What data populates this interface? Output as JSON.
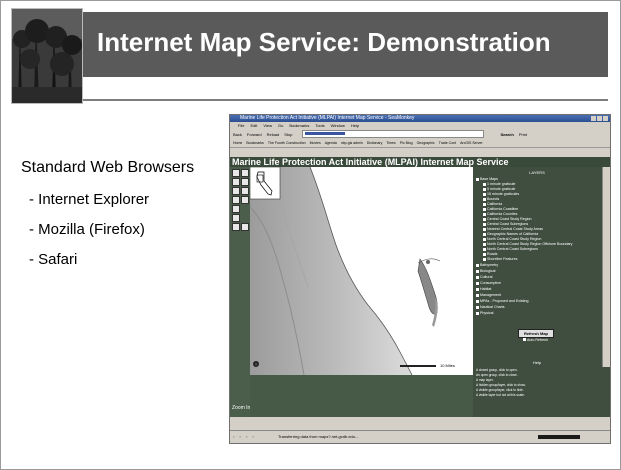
{
  "slide": {
    "title": "Internet Map Service: Demonstration"
  },
  "bullets": {
    "heading": "Standard Web Browsers",
    "items": [
      "- Internet Explorer",
      "- Mozilla (Firefox)",
      "- Safari"
    ]
  },
  "browser": {
    "window_title": "Marine Life Protection Act Initiative (MLPAI) Internet Map Service - SeaMonkey",
    "menu": [
      "File",
      "Edit",
      "View",
      "Go",
      "Bookmarks",
      "Tools",
      "Window",
      "Help"
    ],
    "nav": {
      "back": "Back",
      "forward": "Forward",
      "reload": "Reload",
      "stop": "Stop",
      "search": "Search",
      "print": "Print"
    },
    "bookmarks": [
      "Home",
      "Bookmarks",
      "The Fourth Construction",
      "Movies",
      "Agenda",
      "nbp-gis admin",
      "Dictionary",
      "Times",
      "Pic Blog",
      "Geographic",
      "Trade Cont",
      "ArcGIS Server"
    ],
    "page_header": "Marine Life Protection Act Initiative (MLPAI) Internet Map Service",
    "scale_label": "10 Miles",
    "layers_title": "LAYERS",
    "layers": [
      "Base Maps",
      "1 minute graticule",
      "5 minute graticule",
      "15 minute graticules",
      "Bounds",
      "California",
      "California Coastline",
      "California Counties",
      "Central Coast Study Region",
      "Central Coast Subregions",
      "Nearest Central Coast Study Areas",
      "Geographic Names of California",
      "North Central Coast Study Region",
      "North Central Coast Study Region Offshore Boundary",
      "North Central Coast Subregions",
      "Roads",
      "Shoreline Features",
      "Bathymetry",
      "Biological",
      "Cultural",
      "Consumptive",
      "Habitat",
      "Management",
      "MPAs - Proposed and Existing",
      "Nautical Charts",
      "Physical"
    ],
    "refresh_label": "Refresh Map",
    "auto_refresh_label": "Auto Refresh",
    "help_title": "Help",
    "help_items": [
      "A closed group, click to open.",
      "An open group, click to close.",
      "A map layer.",
      "A hidden group/layer, click to show.",
      "A visible group/layer, click to hide.",
      "A visible layer but not at this scale."
    ],
    "zoom_to": "Zoom In",
    "status_text": "Transferring data from maps?.net-gvdb.edu..."
  }
}
